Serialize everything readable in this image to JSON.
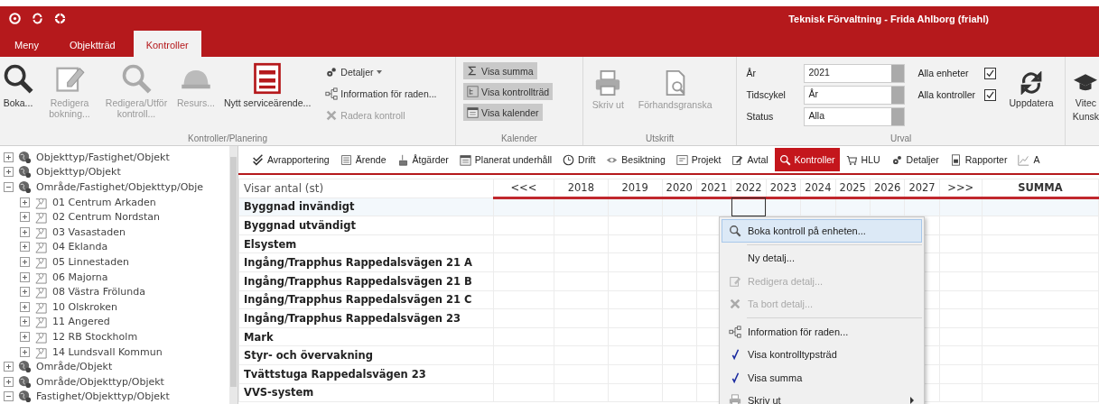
{
  "title_bar": {
    "title": "Teknisk Förvaltning - Frida Ahlborg (friahl)"
  },
  "tabs": [
    {
      "label": "Meny",
      "selected": false
    },
    {
      "label": "Objektträd",
      "selected": false
    },
    {
      "label": "Kontroller",
      "selected": true
    }
  ],
  "ribbon": {
    "planning": {
      "label": "Kontroller/Planering",
      "large_buttons": [
        {
          "label": "Boka...",
          "disabled": false
        },
        {
          "label": "Redigera bokning...",
          "disabled": true
        },
        {
          "label": "Redigera/Utför kontroll...",
          "disabled": true
        },
        {
          "label": "Resurs...",
          "disabled": true
        },
        {
          "label": "Nytt serviceärende...",
          "disabled": false
        }
      ],
      "small_buttons": [
        {
          "label": "Detaljer",
          "disabled": false,
          "dropdown": true
        },
        {
          "label": "Information för raden...",
          "disabled": false,
          "dropdown": false
        },
        {
          "label": "Radera kontroll",
          "disabled": true,
          "dropdown": false
        }
      ]
    },
    "calendar": {
      "label": "Kalender",
      "toggles": [
        {
          "label": "Visa summa",
          "selected": true
        },
        {
          "label": "Visa kontrollträd",
          "selected": true
        },
        {
          "label": "Visa kalender",
          "selected": true
        }
      ]
    },
    "print": {
      "label": "Utskrift",
      "buttons": [
        {
          "label": "Skriv ut",
          "disabled": true
        },
        {
          "label": "Förhandsgranska",
          "disabled": true
        }
      ]
    },
    "filter": {
      "label": "Urval",
      "fields": [
        {
          "label": "År",
          "value": "2021"
        },
        {
          "label": "Tidscykel",
          "value": "År"
        },
        {
          "label": "Status",
          "value": "Alla"
        }
      ],
      "checks": [
        {
          "label": "Alla enheter",
          "checked": true
        },
        {
          "label": "Alla kontroller",
          "checked": true
        }
      ],
      "refresh_button": "Uppdatera"
    },
    "extra_button": {
      "lines": [
        "Vitec",
        "Kunsk"
      ]
    }
  },
  "tree": [
    {
      "label": "Objekttyp/Fastighet/Objekt",
      "expanded": false
    },
    {
      "label": "Objekttyp/Objekt",
      "expanded": false
    },
    {
      "label": "Område/Fastighet/Objekttyp/Obje",
      "expanded": true,
      "children": [
        {
          "label": "01 Centrum Arkaden",
          "expanded": false
        },
        {
          "label": "02 Centrum Nordstan",
          "expanded": false
        },
        {
          "label": "03 Vasastaden",
          "expanded": false
        },
        {
          "label": "04 Eklanda",
          "expanded": false
        },
        {
          "label": "05 Linnestaden",
          "expanded": false
        },
        {
          "label": "06 Majorna",
          "expanded": false
        },
        {
          "label": "08 Västra Frölunda",
          "expanded": false
        },
        {
          "label": "10 Olskroken",
          "expanded": false
        },
        {
          "label": "11 Angered",
          "expanded": false
        },
        {
          "label": "12 RB Stockholm",
          "expanded": false
        },
        {
          "label": "14 Lundsvall Kommun",
          "expanded": false
        }
      ]
    },
    {
      "label": "Område/Objekt",
      "expanded": false
    },
    {
      "label": "Område/Objekttyp/Objekt",
      "expanded": false
    },
    {
      "label": "Fastighet/Objekttyp/Objekt",
      "expanded": true
    }
  ],
  "modules": [
    {
      "label": "Avrapportering",
      "selected": false
    },
    {
      "label": "Ärende",
      "selected": false
    },
    {
      "label": "Åtgärder",
      "selected": false
    },
    {
      "label": "Planerat underhåll",
      "selected": false
    },
    {
      "label": "Drift",
      "selected": false
    },
    {
      "label": "Besiktning",
      "selected": false
    },
    {
      "label": "Projekt",
      "selected": false
    },
    {
      "label": "Avtal",
      "selected": false
    },
    {
      "label": "Kontroller",
      "selected": true
    },
    {
      "label": "HLU",
      "selected": false
    },
    {
      "label": "Detaljer",
      "selected": false
    },
    {
      "label": "Rapporter",
      "selected": false
    },
    {
      "label": "A",
      "selected": false
    }
  ],
  "grid": {
    "name_header": "Visar antal (st)",
    "columns": [
      {
        "label": "<<<",
        "selected": false
      },
      {
        "label": "2018",
        "selected": false
      },
      {
        "label": "2019",
        "selected": false
      },
      {
        "label": "2020",
        "selected": false
      },
      {
        "label": "2021",
        "selected": false
      },
      {
        "label": "2022",
        "selected": true
      },
      {
        "label": "2023",
        "selected": false
      },
      {
        "label": "2024",
        "selected": false
      },
      {
        "label": "2025",
        "selected": false
      },
      {
        "label": "2026",
        "selected": false
      },
      {
        "label": "2027",
        "selected": false
      },
      {
        "label": ">>>",
        "selected": false
      },
      {
        "label": "SUMMA",
        "selected": false
      }
    ],
    "rows": [
      {
        "label": "Byggnad invändigt",
        "selected": true
      },
      {
        "label": "Byggnad utvändigt",
        "selected": false
      },
      {
        "label": "Elsystem",
        "selected": false
      },
      {
        "label": "Ingång/Trapphus Rappedalsvägen 21 A",
        "selected": false
      },
      {
        "label": "Ingång/Trapphus Rappedalsvägen 21 B",
        "selected": false
      },
      {
        "label": "Ingång/Trapphus Rappedalsvägen 21 C",
        "selected": false
      },
      {
        "label": "Ingång/Trapphus Rappedalsvägen 23",
        "selected": false
      },
      {
        "label": "Mark",
        "selected": false
      },
      {
        "label": "Styr- och övervakning",
        "selected": false
      },
      {
        "label": "Tvättstuga Rappedalsvägen 23",
        "selected": false
      },
      {
        "label": "VVS-system",
        "selected": false
      }
    ]
  },
  "context_menu": [
    {
      "label": "Boka kontroll på enheten...",
      "selected": true,
      "disabled": false,
      "checked": false,
      "separator_before": false,
      "submenu": false
    },
    {
      "label": "Ny detalj...",
      "selected": false,
      "disabled": false,
      "checked": false,
      "separator_before": true,
      "submenu": false
    },
    {
      "label": "Redigera detalj...",
      "selected": false,
      "disabled": true,
      "checked": false,
      "separator_before": false,
      "submenu": false
    },
    {
      "label": "Ta bort detalj...",
      "selected": false,
      "disabled": true,
      "checked": false,
      "separator_before": false,
      "submenu": false
    },
    {
      "label": "Information för raden...",
      "selected": false,
      "disabled": false,
      "checked": false,
      "separator_before": true,
      "submenu": false
    },
    {
      "label": "Visa kontrolltypsträd",
      "selected": false,
      "disabled": false,
      "checked": true,
      "separator_before": false,
      "submenu": false
    },
    {
      "label": "Visa summa",
      "selected": false,
      "disabled": false,
      "checked": true,
      "separator_before": false,
      "submenu": false
    },
    {
      "label": "Skriv ut",
      "selected": false,
      "disabled": false,
      "checked": false,
      "separator_before": false,
      "submenu": true
    }
  ]
}
